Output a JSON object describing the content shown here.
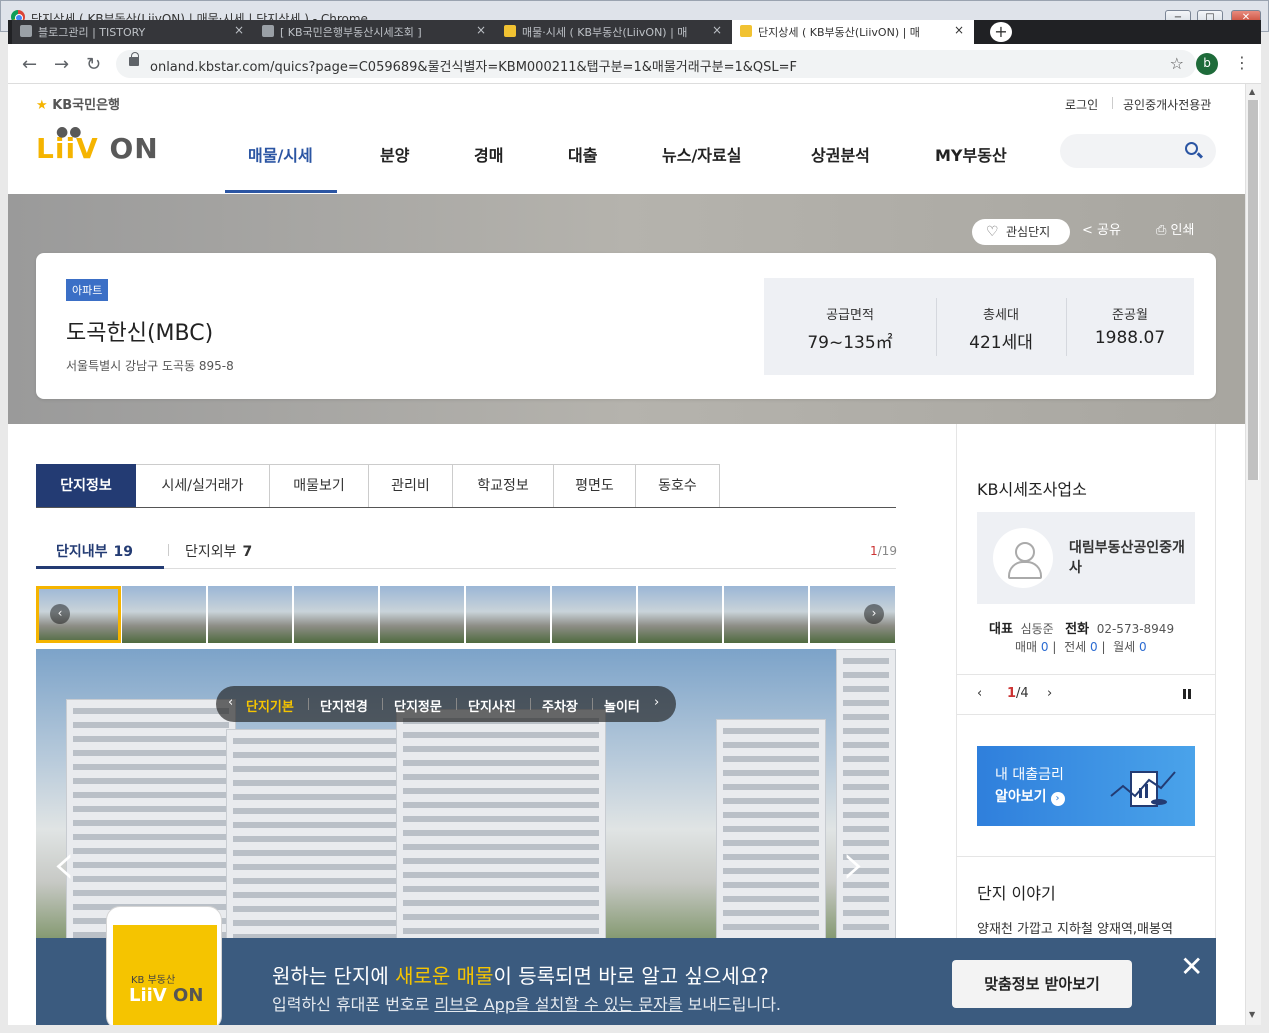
{
  "window": {
    "title": "단지상세 ( KB부동산(LiivON) | 매물·시세 | 단지상세 ) - Chrome",
    "min": "−",
    "max": "□",
    "close": "✕"
  },
  "tabs": [
    {
      "label": "블로그관리 | TISTORY",
      "close": "×"
    },
    {
      "label": "[ KB국민은행부동산시세조회 ]",
      "close": "×"
    },
    {
      "label": "매물·시세 ( KB부동산(LiivON) | 매",
      "close": "×"
    },
    {
      "label": "단지상세 ( KB부동산(LiivON) | 매",
      "close": "×"
    }
  ],
  "newtab": "+",
  "nav": {
    "back": "←",
    "forward": "→",
    "reload": "↻"
  },
  "omnibox": {
    "url": "onland.kbstar.com/quics?page=C059689&물건식별자=KBM000211&탭구분=1&매물거래구분=1&QSL=F",
    "star": "☆"
  },
  "profile": "b",
  "menu_icon": "⋮",
  "header": {
    "bank_logo": "KB국민은행",
    "bank_star": "★",
    "liiv": "LiiV",
    "on": "ON",
    "dots": "●●",
    "login": "로그인",
    "agent_hall": "공인중개사전용관",
    "gnb": [
      "매물/시세",
      "분양",
      "경매",
      "대출",
      "뉴스/자료실",
      "상권분석",
      "MY부동산"
    ]
  },
  "hero": {
    "favorite": "관심단지",
    "heart": "♡",
    "share": "공유",
    "print": "인쇄",
    "share_icon": "<",
    "print_icon": "⎙",
    "type_badge": "아파트",
    "name": "도곡한신(MBC)",
    "address": "서울특별시 강남구 도곡동 895-8",
    "stats": [
      {
        "label": "공급면적",
        "value": "79~135㎡"
      },
      {
        "label": "총세대",
        "value": "421세대"
      },
      {
        "label": "준공월",
        "value": "1988.07"
      }
    ]
  },
  "main_tabs": [
    "단지정보",
    "시세/실거래가",
    "매물보기",
    "관리비",
    "학교정보",
    "평면도",
    "동호수"
  ],
  "sub_tabs": [
    {
      "label": "단지내부",
      "count": "19"
    },
    {
      "label": "단지외부",
      "count": "7"
    }
  ],
  "photo_pager": {
    "current": "1",
    "total": "/19"
  },
  "thumb_arrows": {
    "prev": "‹",
    "next": "›"
  },
  "photo_nav": {
    "prev": "‹",
    "next": "›",
    "items": [
      "단지기본",
      "단지전경",
      "단지정문",
      "단지사진",
      "주차장",
      "놀이터"
    ]
  },
  "big_arrows": {
    "prev": "‹",
    "next": "›"
  },
  "sidebar": {
    "title": "KB시세조사업소",
    "agent_name": "대림부동산공인중개사",
    "rep_label": "대표",
    "rep_name": "심동준",
    "phone_label": "전화",
    "phone": "02-573-8949",
    "counts": [
      {
        "label": "매매",
        "value": "0"
      },
      {
        "label": "전세",
        "value": "0"
      },
      {
        "label": "월세",
        "value": "0"
      }
    ],
    "pager_prev": "‹",
    "pager_next": "›",
    "pager_current": "1",
    "pager_total": "/4",
    "loan_line1": "내 대출금리",
    "loan_line2": "알아보기",
    "loan_go": "›",
    "story_title": "단지 이야기",
    "story_text": "양재천 가깝고 지하철 양재역,매봉역"
  },
  "banner": {
    "phone_kb": "KB 부동산",
    "phone_liiv": "LiiV",
    "phone_on": "ON",
    "main_pre": "원하는 단지에 ",
    "main_hl": "새로운 매물",
    "main_post": "이 등록되면 바로 알고 싶으세요?",
    "sub_pre": "입력하신 휴대폰 번호로 ",
    "sub_link": "리브온 App을 설치할 수 있는 문자를",
    "sub_post": " 보내드립니다.",
    "button": "맞춤정보 받아보기",
    "close": "✕"
  },
  "scroll": {
    "up": "▲",
    "down": "▼"
  }
}
